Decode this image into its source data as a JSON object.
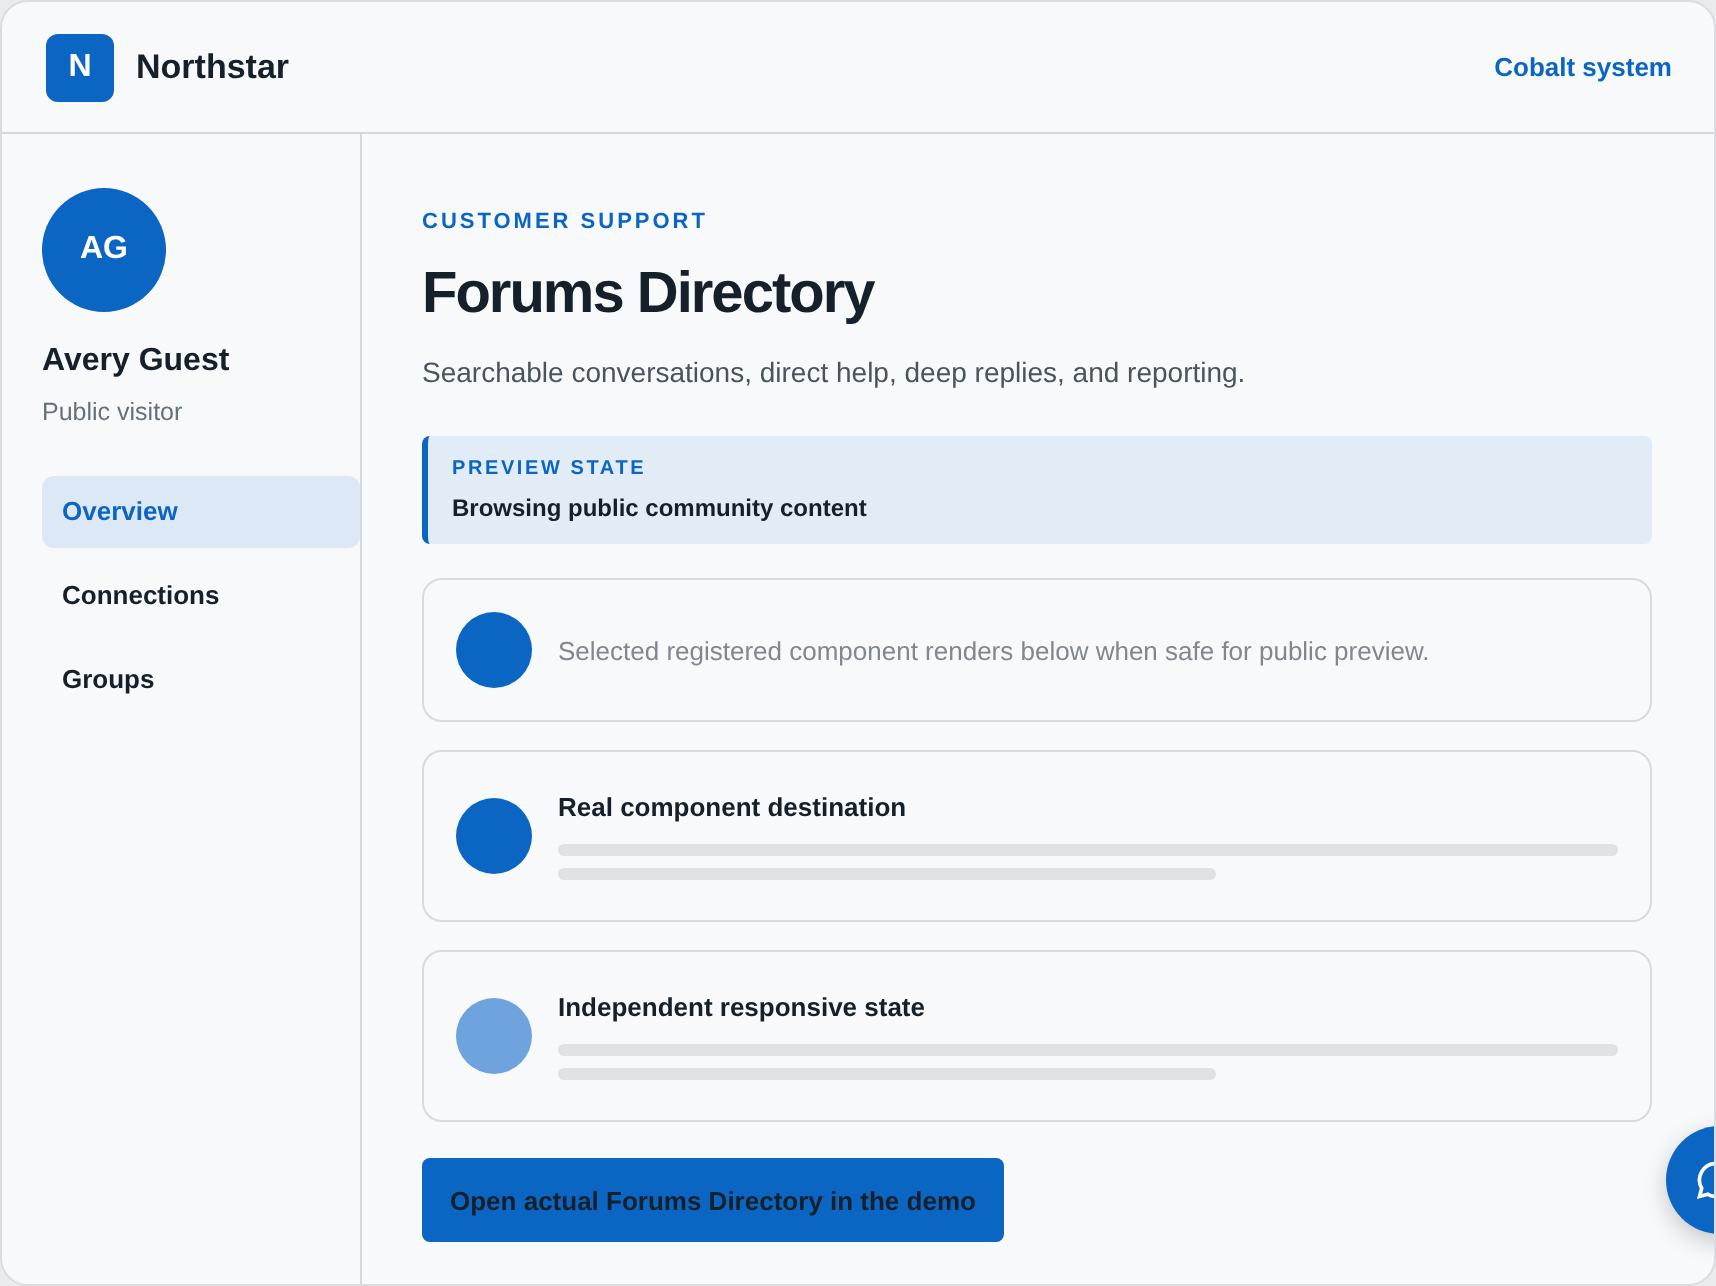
{
  "brand": {
    "logo": "N",
    "name": "Northstar"
  },
  "header_link": "Cobalt system",
  "profile": {
    "initials": "AG",
    "name": "Avery Guest",
    "role": "Public visitor"
  },
  "nav": [
    {
      "label": "Overview",
      "selected": true
    },
    {
      "label": "Connections",
      "selected": false
    },
    {
      "label": "Groups",
      "selected": false
    }
  ],
  "eyebrow": "CUSTOMER SUPPORT",
  "title": "Forums Directory",
  "subtitle": "Searchable conversations, direct help, deep replies, and reporting.",
  "notice": {
    "label": "PREVIEW STATE",
    "text": "Browsing public community content"
  },
  "cards": [
    {
      "kind": "note",
      "color": "#0b66c3",
      "text": "Selected registered component renders below when safe for public preview."
    },
    {
      "kind": "skeleton",
      "color": "#0b66c3",
      "text": "Real component destination"
    },
    {
      "kind": "skeleton",
      "color": "#6fa3dd",
      "text": "Independent responsive state"
    }
  ],
  "action": "Open actual Forums Directory in the demo"
}
